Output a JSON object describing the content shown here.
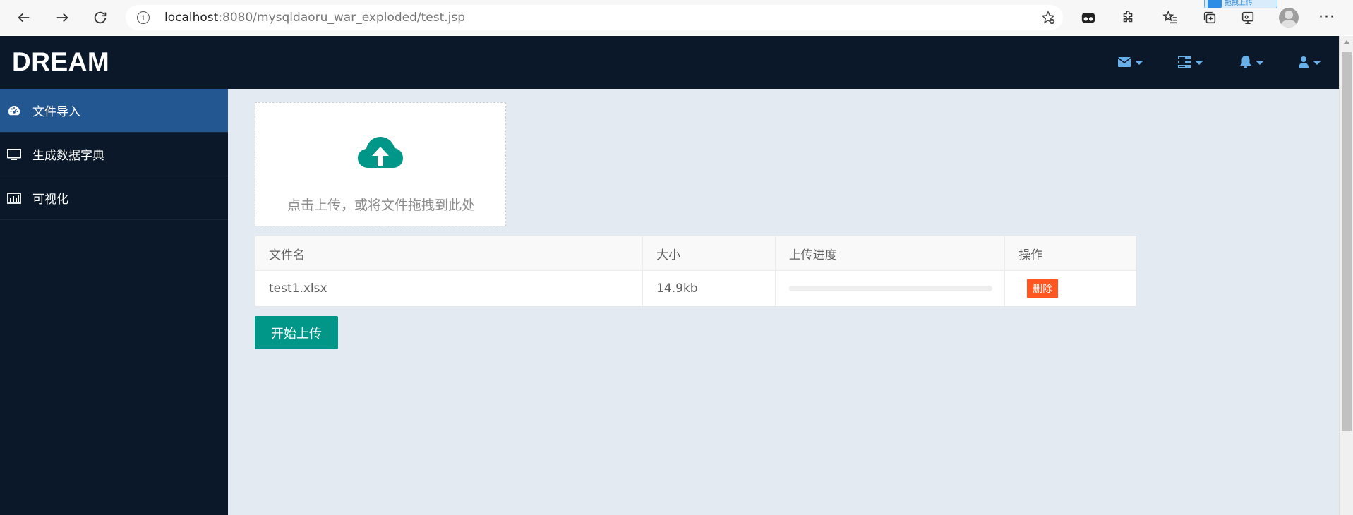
{
  "browser": {
    "url_host": "localhost",
    "url_rest": ":8080/mysqldaoru_war_exploded/test.jsp",
    "tooltip": "拖拽上传"
  },
  "header": {
    "brand": "DREAM",
    "icons": [
      "envelope-icon",
      "server-icon",
      "bell-icon",
      "user-icon"
    ],
    "accent": "#6ab0e8",
    "background": "#0b1829"
  },
  "sidebar": {
    "active_color": "#235791",
    "items": [
      {
        "label": "文件导入",
        "icon": "dashboard-icon",
        "active": true
      },
      {
        "label": "生成数据字典",
        "icon": "desktop-icon",
        "active": false
      },
      {
        "label": "可视化",
        "icon": "bar-chart-icon",
        "active": false
      }
    ]
  },
  "upload": {
    "hint": "点击上传，或将文件拖拽到此处",
    "icon": "cloud-upload-icon",
    "icon_color": "#009688"
  },
  "table": {
    "headers": [
      "文件名",
      "大小",
      "上传进度",
      "操作"
    ],
    "rows": [
      {
        "name": "test1.xlsx",
        "size": "14.9kb",
        "progress": 0,
        "action": "删除"
      }
    ]
  },
  "actions": {
    "start_upload": "开始上传",
    "primary_color": "#009688",
    "danger_color": "#ff5722"
  }
}
